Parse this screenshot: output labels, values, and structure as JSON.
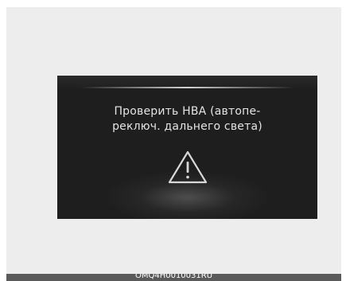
{
  "display": {
    "message_line1": "Проверить HBA (автопе-",
    "message_line2": "реключ. дальнего света)",
    "icon": "warning-triangle-icon"
  },
  "figure": {
    "code": "OMQ4H0010031RU"
  },
  "colors": {
    "screen_background": "#1e1e1e",
    "text": "#e4e4e4",
    "frame_background": "#ededed",
    "caption_bar": "#5a5a5a"
  }
}
